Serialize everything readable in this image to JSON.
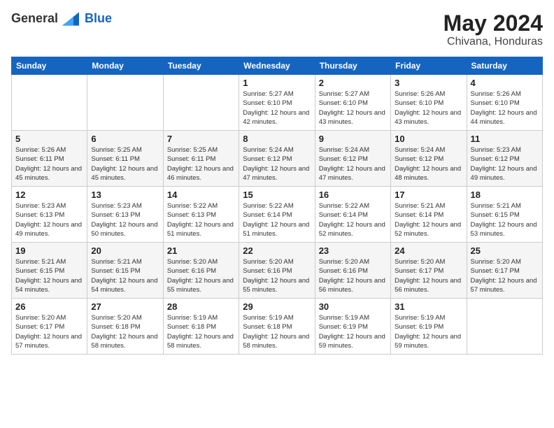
{
  "logo": {
    "general": "General",
    "blue": "Blue"
  },
  "title": {
    "month_year": "May 2024",
    "location": "Chivana, Honduras"
  },
  "weekdays": [
    "Sunday",
    "Monday",
    "Tuesday",
    "Wednesday",
    "Thursday",
    "Friday",
    "Saturday"
  ],
  "weeks": [
    [
      {
        "day": "",
        "sunrise": "",
        "sunset": "",
        "daylight": ""
      },
      {
        "day": "",
        "sunrise": "",
        "sunset": "",
        "daylight": ""
      },
      {
        "day": "",
        "sunrise": "",
        "sunset": "",
        "daylight": ""
      },
      {
        "day": "1",
        "sunrise": "Sunrise: 5:27 AM",
        "sunset": "Sunset: 6:10 PM",
        "daylight": "Daylight: 12 hours and 42 minutes."
      },
      {
        "day": "2",
        "sunrise": "Sunrise: 5:27 AM",
        "sunset": "Sunset: 6:10 PM",
        "daylight": "Daylight: 12 hours and 43 minutes."
      },
      {
        "day": "3",
        "sunrise": "Sunrise: 5:26 AM",
        "sunset": "Sunset: 6:10 PM",
        "daylight": "Daylight: 12 hours and 43 minutes."
      },
      {
        "day": "4",
        "sunrise": "Sunrise: 5:26 AM",
        "sunset": "Sunset: 6:10 PM",
        "daylight": "Daylight: 12 hours and 44 minutes."
      }
    ],
    [
      {
        "day": "5",
        "sunrise": "Sunrise: 5:26 AM",
        "sunset": "Sunset: 6:11 PM",
        "daylight": "Daylight: 12 hours and 45 minutes."
      },
      {
        "day": "6",
        "sunrise": "Sunrise: 5:25 AM",
        "sunset": "Sunset: 6:11 PM",
        "daylight": "Daylight: 12 hours and 45 minutes."
      },
      {
        "day": "7",
        "sunrise": "Sunrise: 5:25 AM",
        "sunset": "Sunset: 6:11 PM",
        "daylight": "Daylight: 12 hours and 46 minutes."
      },
      {
        "day": "8",
        "sunrise": "Sunrise: 5:24 AM",
        "sunset": "Sunset: 6:12 PM",
        "daylight": "Daylight: 12 hours and 47 minutes."
      },
      {
        "day": "9",
        "sunrise": "Sunrise: 5:24 AM",
        "sunset": "Sunset: 6:12 PM",
        "daylight": "Daylight: 12 hours and 47 minutes."
      },
      {
        "day": "10",
        "sunrise": "Sunrise: 5:24 AM",
        "sunset": "Sunset: 6:12 PM",
        "daylight": "Daylight: 12 hours and 48 minutes."
      },
      {
        "day": "11",
        "sunrise": "Sunrise: 5:23 AM",
        "sunset": "Sunset: 6:12 PM",
        "daylight": "Daylight: 12 hours and 49 minutes."
      }
    ],
    [
      {
        "day": "12",
        "sunrise": "Sunrise: 5:23 AM",
        "sunset": "Sunset: 6:13 PM",
        "daylight": "Daylight: 12 hours and 49 minutes."
      },
      {
        "day": "13",
        "sunrise": "Sunrise: 5:23 AM",
        "sunset": "Sunset: 6:13 PM",
        "daylight": "Daylight: 12 hours and 50 minutes."
      },
      {
        "day": "14",
        "sunrise": "Sunrise: 5:22 AM",
        "sunset": "Sunset: 6:13 PM",
        "daylight": "Daylight: 12 hours and 51 minutes."
      },
      {
        "day": "15",
        "sunrise": "Sunrise: 5:22 AM",
        "sunset": "Sunset: 6:14 PM",
        "daylight": "Daylight: 12 hours and 51 minutes."
      },
      {
        "day": "16",
        "sunrise": "Sunrise: 5:22 AM",
        "sunset": "Sunset: 6:14 PM",
        "daylight": "Daylight: 12 hours and 52 minutes."
      },
      {
        "day": "17",
        "sunrise": "Sunrise: 5:21 AM",
        "sunset": "Sunset: 6:14 PM",
        "daylight": "Daylight: 12 hours and 52 minutes."
      },
      {
        "day": "18",
        "sunrise": "Sunrise: 5:21 AM",
        "sunset": "Sunset: 6:15 PM",
        "daylight": "Daylight: 12 hours and 53 minutes."
      }
    ],
    [
      {
        "day": "19",
        "sunrise": "Sunrise: 5:21 AM",
        "sunset": "Sunset: 6:15 PM",
        "daylight": "Daylight: 12 hours and 54 minutes."
      },
      {
        "day": "20",
        "sunrise": "Sunrise: 5:21 AM",
        "sunset": "Sunset: 6:15 PM",
        "daylight": "Daylight: 12 hours and 54 minutes."
      },
      {
        "day": "21",
        "sunrise": "Sunrise: 5:20 AM",
        "sunset": "Sunset: 6:16 PM",
        "daylight": "Daylight: 12 hours and 55 minutes."
      },
      {
        "day": "22",
        "sunrise": "Sunrise: 5:20 AM",
        "sunset": "Sunset: 6:16 PM",
        "daylight": "Daylight: 12 hours and 55 minutes."
      },
      {
        "day": "23",
        "sunrise": "Sunrise: 5:20 AM",
        "sunset": "Sunset: 6:16 PM",
        "daylight": "Daylight: 12 hours and 56 minutes."
      },
      {
        "day": "24",
        "sunrise": "Sunrise: 5:20 AM",
        "sunset": "Sunset: 6:17 PM",
        "daylight": "Daylight: 12 hours and 56 minutes."
      },
      {
        "day": "25",
        "sunrise": "Sunrise: 5:20 AM",
        "sunset": "Sunset: 6:17 PM",
        "daylight": "Daylight: 12 hours and 57 minutes."
      }
    ],
    [
      {
        "day": "26",
        "sunrise": "Sunrise: 5:20 AM",
        "sunset": "Sunset: 6:17 PM",
        "daylight": "Daylight: 12 hours and 57 minutes."
      },
      {
        "day": "27",
        "sunrise": "Sunrise: 5:20 AM",
        "sunset": "Sunset: 6:18 PM",
        "daylight": "Daylight: 12 hours and 58 minutes."
      },
      {
        "day": "28",
        "sunrise": "Sunrise: 5:19 AM",
        "sunset": "Sunset: 6:18 PM",
        "daylight": "Daylight: 12 hours and 58 minutes."
      },
      {
        "day": "29",
        "sunrise": "Sunrise: 5:19 AM",
        "sunset": "Sunset: 6:18 PM",
        "daylight": "Daylight: 12 hours and 58 minutes."
      },
      {
        "day": "30",
        "sunrise": "Sunrise: 5:19 AM",
        "sunset": "Sunset: 6:19 PM",
        "daylight": "Daylight: 12 hours and 59 minutes."
      },
      {
        "day": "31",
        "sunrise": "Sunrise: 5:19 AM",
        "sunset": "Sunset: 6:19 PM",
        "daylight": "Daylight: 12 hours and 59 minutes."
      },
      {
        "day": "",
        "sunrise": "",
        "sunset": "",
        "daylight": ""
      }
    ]
  ]
}
